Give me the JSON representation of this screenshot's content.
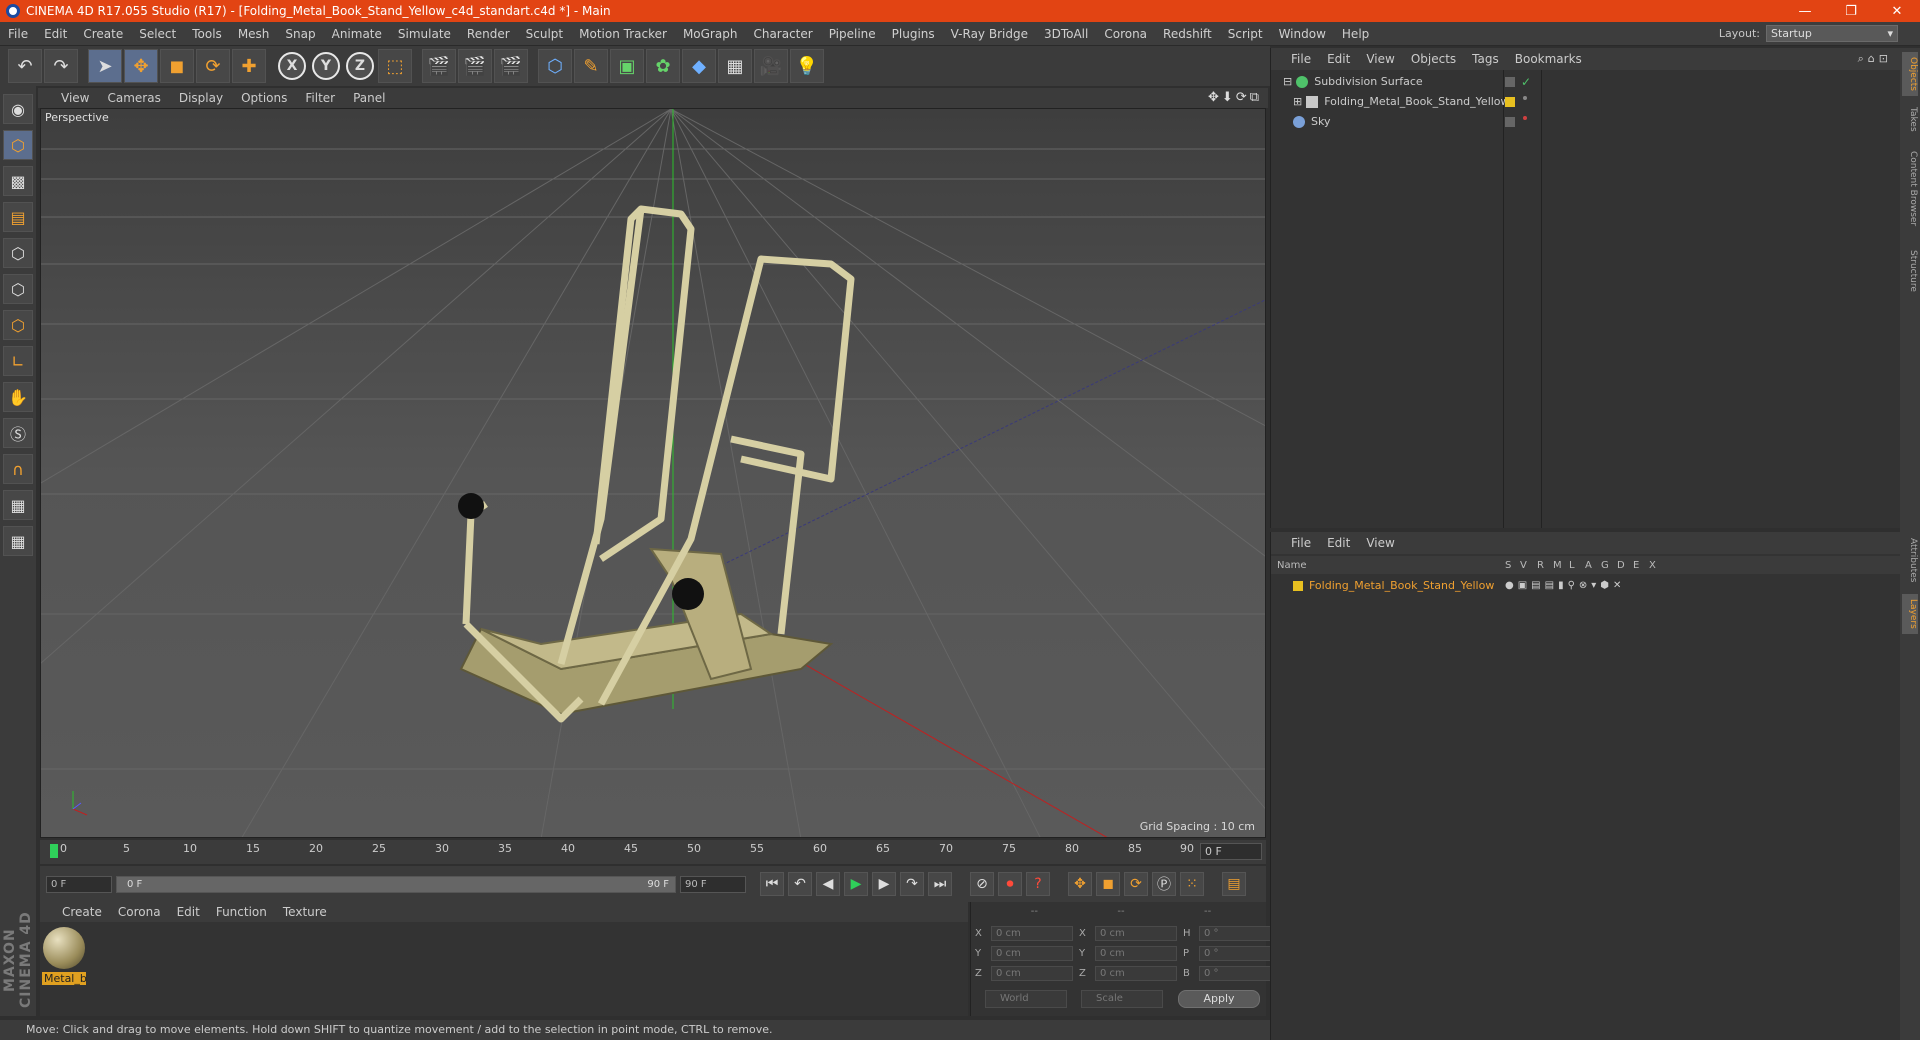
{
  "window": {
    "title": "CINEMA 4D R17.055 Studio (R17) - [Folding_Metal_Book_Stand_Yellow_c4d_standart.c4d *] - Main",
    "controls": [
      "—",
      "❐",
      "✕"
    ]
  },
  "menubar": {
    "items": [
      "File",
      "Edit",
      "Create",
      "Select",
      "Tools",
      "Mesh",
      "Snap",
      "Animate",
      "Simulate",
      "Render",
      "Sculpt",
      "Motion Tracker",
      "MoGraph",
      "Character",
      "Pipeline",
      "Plugins",
      "V-Ray Bridge",
      "3DToAll",
      "Corona",
      "Redshift",
      "Script",
      "Window",
      "Help"
    ],
    "layout_label": "Layout:",
    "layout_value": "Startup"
  },
  "viewport": {
    "menu": [
      "View",
      "Cameras",
      "Display",
      "Options",
      "Filter",
      "Panel"
    ],
    "label": "Perspective",
    "grid_spacing": "Grid Spacing : 10 cm"
  },
  "timeline": {
    "ticks": [
      "0",
      "5",
      "10",
      "15",
      "20",
      "25",
      "30",
      "35",
      "40",
      "45",
      "50",
      "55",
      "60",
      "65",
      "70",
      "75",
      "80",
      "85",
      "90"
    ],
    "current_frame": "0 F",
    "start_field": "0 F",
    "range_start": "0 F",
    "range_end": "90 F",
    "end_field": "90 F"
  },
  "material_manager": {
    "menu": [
      "Create",
      "Corona",
      "Edit",
      "Function",
      "Texture"
    ],
    "materials": [
      {
        "name": "Metal_b"
      }
    ]
  },
  "coordinates": {
    "headers": [
      "--",
      "--",
      "--"
    ],
    "rows": [
      {
        "a": "X",
        "av": "0 cm",
        "b": "X",
        "bv": "0 cm",
        "c": "H",
        "cv": "0 °"
      },
      {
        "a": "Y",
        "av": "0 cm",
        "b": "Y",
        "bv": "0 cm",
        "c": "P",
        "cv": "0 °"
      },
      {
        "a": "Z",
        "av": "0 cm",
        "b": "Z",
        "bv": "0 cm",
        "c": "B",
        "cv": "0 °"
      }
    ],
    "mode1": "World",
    "mode2": "Scale",
    "apply_label": "Apply"
  },
  "status": "Move: Click and drag to move elements. Hold down SHIFT to quantize movement / add to the selection in point mode, CTRL to remove.",
  "object_manager": {
    "menu": [
      "File",
      "Edit",
      "View",
      "Objects",
      "Tags",
      "Bookmarks"
    ],
    "objects": [
      {
        "name": "Subdivision Surface",
        "color": "#4fc26a"
      },
      {
        "name": "Folding_Metal_Book_Stand_Yellow",
        "color": "#c8c8c8"
      },
      {
        "name": "Sky",
        "color": "#7aa0d8"
      }
    ]
  },
  "layer_manager": {
    "menu": [
      "File",
      "Edit",
      "View"
    ],
    "columns": [
      "Name",
      "S",
      "V",
      "R",
      "M",
      "L",
      "A",
      "G",
      "D",
      "E",
      "X"
    ],
    "layers": [
      {
        "name": "Folding_Metal_Book_Stand_Yellow",
        "color": "#e8c020"
      }
    ]
  },
  "side_tabs": [
    "Objects",
    "Takes",
    "Content Browser",
    "Structure",
    "Attributes",
    "Layers"
  ],
  "brand": "MAXON CINEMA 4D",
  "colors": {
    "accent": "#e24413",
    "selection_orange": "#f0a030",
    "layer_yellow": "#e8c020"
  }
}
